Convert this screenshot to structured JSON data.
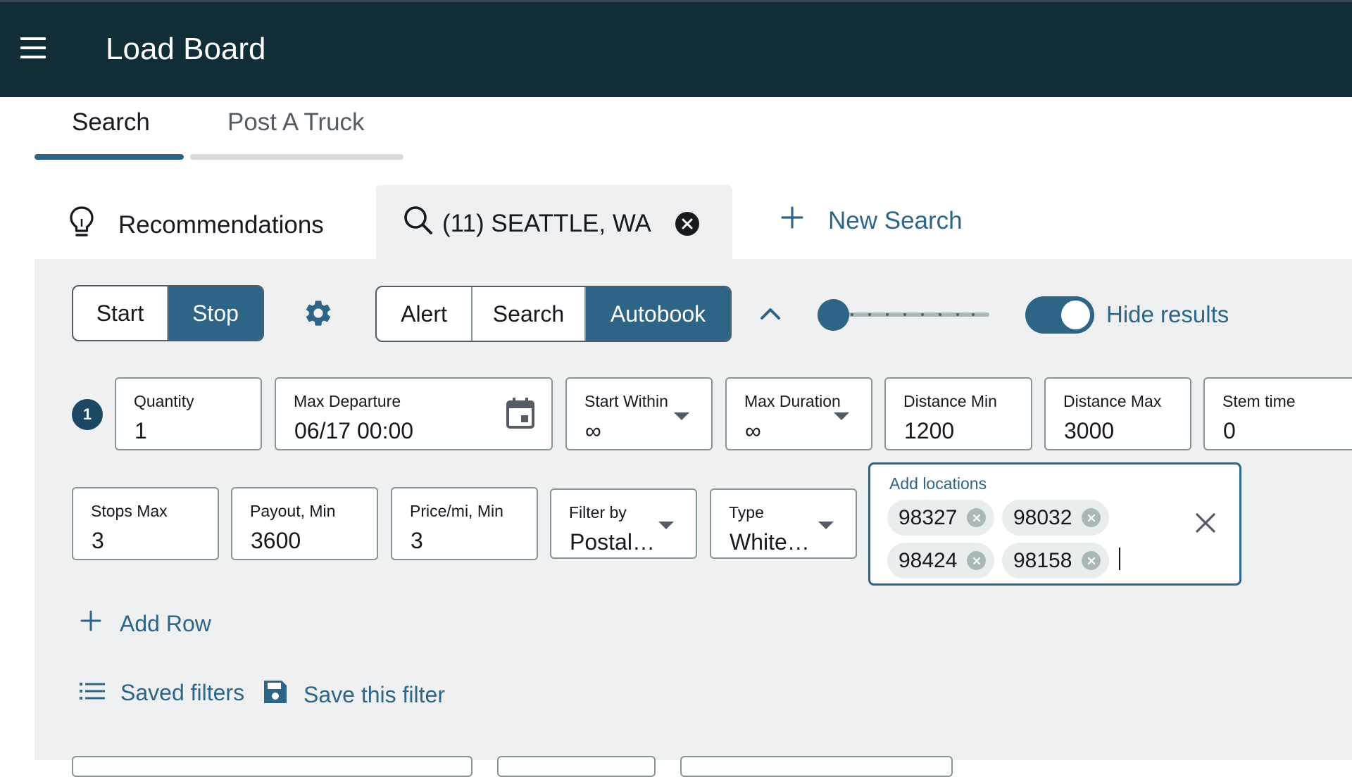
{
  "header": {
    "title": "Load Board"
  },
  "tabs": [
    {
      "label": "Search",
      "active": true
    },
    {
      "label": "Post A Truck",
      "active": false
    }
  ],
  "search_tabs": {
    "recommendations": "Recommendations",
    "active_search": "(11) SEATTLE, WA",
    "new_search": "New Search"
  },
  "controls": {
    "start_label": "Start",
    "stop_label": "Stop",
    "startstop_selected": "Stop",
    "mode_options": [
      "Alert",
      "Search",
      "Autobook"
    ],
    "mode_selected": "Autobook",
    "hide_results_label": "Hide results",
    "hide_results_on": true,
    "slider_level": 0
  },
  "row1": {
    "number": "1",
    "quantity": {
      "label": "Quantity",
      "value": "1"
    },
    "max_departure": {
      "label": "Max Departure",
      "value": "06/17 00:00"
    },
    "start_within": {
      "label": "Start Within",
      "value": "∞"
    },
    "max_duration": {
      "label": "Max Duration",
      "value": "∞"
    },
    "distance_min": {
      "label": "Distance Min",
      "value": "1200"
    },
    "distance_max": {
      "label": "Distance Max",
      "value": "3000"
    },
    "stem_time": {
      "label": "Stem time",
      "value": "0"
    }
  },
  "row2": {
    "stops_max": {
      "label": "Stops Max",
      "value": "3"
    },
    "payout_min": {
      "label": "Payout, Min",
      "value": "3600"
    },
    "price_mi_min": {
      "label": "Price/mi, Min",
      "value": "3"
    },
    "filter_by": {
      "label": "Filter by",
      "value": "Postal…"
    },
    "type": {
      "label": "Type",
      "value": "White…"
    }
  },
  "locations": {
    "label": "Add locations",
    "chips": [
      "98327",
      "98032",
      "98424",
      "98158"
    ]
  },
  "actions": {
    "add_row": "Add Row",
    "saved_filters": "Saved filters",
    "save_this_filter": "Save this filter"
  },
  "colors": {
    "header_bg": "#112e38",
    "accent": "#2e6485",
    "panel_bg": "#eef0f1"
  }
}
